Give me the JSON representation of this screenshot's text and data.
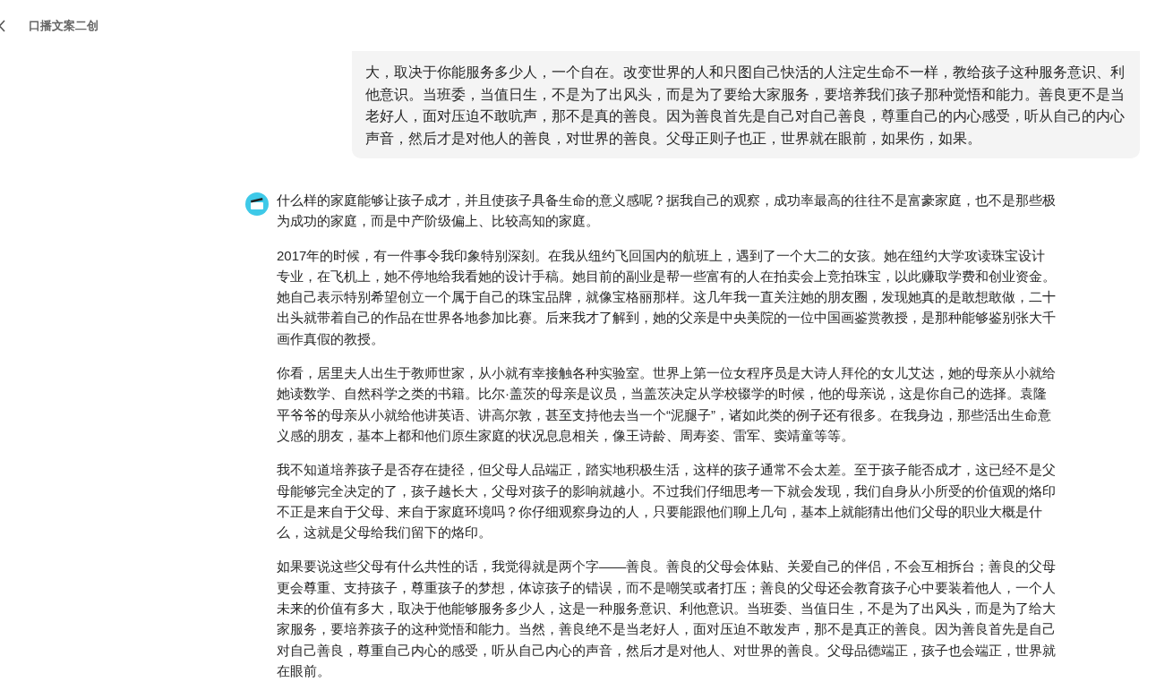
{
  "header": {
    "title": "口播文案二创"
  },
  "user_message": {
    "lines": [
      "大，取决于你能服务多少人，一个自在。改变世界的人和只图自己快活的人注定生命不一样，教给孩子这种服务意识、利",
      "他意识。当班委，当值日生，不是为了出风头，而是为了要给大家服务，要培养我们孩子那种觉悟和能力。善良更不是当",
      "老好人，面对压迫不敢吭声，那不是真的善良。因为善良首先是自己对自己善良，尊重自己的内心感受，听从自己的内心",
      "声音，然后才是对他人的善良，对世界的善良。父母正则子也正，世界就在眼前，如果伤，如果。"
    ]
  },
  "assistant_message": {
    "paragraphs": [
      {
        "lines": [
          "什么样的家庭能够让孩子成才，并且使孩子具备生命的意义感呢？据我自己的观察，成功率最高的往往不是富豪家庭，也不是那些极",
          "为成功的家庭，而是中产阶级偏上、比较高知的家庭。"
        ]
      },
      {
        "lines": [
          "2017年的时候，有一件事令我印象特别深刻。在我从纽约飞回国内的航班上，遇到了一个大二的女孩。她在纽约大学攻读珠宝设计",
          "专业，在飞机上，她不停地给我看她的设计手稿。她目前的副业是帮一些富有的人在拍卖会上竞拍珠宝，以此赚取学费和创业资金。",
          "她自己表示特别希望创立一个属于自己的珠宝品牌，就像宝格丽那样。这几年我一直关注她的朋友圈，发现她真的是敢想敢做，二十",
          "出头就带着自己的作品在世界各地参加比赛。后来我才了解到，她的父亲是中央美院的一位中国画鉴赏教授，是那种能够鉴别张大千",
          "画作真假的教授。"
        ]
      },
      {
        "lines": [
          "你看，居里夫人出生于教师世家，从小就有幸接触各种实验室。世界上第一位女程序员是大诗人拜伦的女儿艾达，她的母亲从小就给",
          "她读数学、自然科学之类的书籍。比尔·盖茨的母亲是议员，当盖茨决定从学校辍学的时候，他的母亲说，这是你自己的选择。袁隆",
          "平爷爷的母亲从小就给他讲英语、讲高尔敦，甚至支持他去当一个“泥腿子”，诸如此类的例子还有很多。在我身边，那些活出生命意",
          "义感的朋友，基本上都和他们原生家庭的状况息息相关，像王诗龄、周寿姿、雷军、窦靖童等等。"
        ]
      },
      {
        "lines": [
          "我不知道培养孩子是否存在捷径，但父母人品端正，踏实地积极生活，这样的孩子通常不会太差。至于孩子能否成才，这已经不是父",
          "母能够完全决定的了，孩子越长大，父母对孩子的影响就越小。不过我们仔细思考一下就会发现，我们自身从小所受的价值观的烙印",
          "不正是来自于父母、来自于家庭环境吗？你仔细观察身边的人，只要能跟他们聊上几句，基本上就能猜出他们父母的职业大概是什",
          "么，这就是父母给我们留下的烙印。"
        ]
      },
      {
        "lines": [
          "如果要说这些父母有什么共性的话，我觉得就是两个字——善良。善良的父母会体贴、关爱自己的伴侣，不会互相拆台；善良的父母",
          "更会尊重、支持孩子，尊重孩子的梦想，体谅孩子的错误，而不是嘲笑或者打压；善良的父母还会教育孩子心中要装着他人，一个人",
          "未来的价值有多大，取决于他能够服务多少人，这是一种服务意识、利他意识。当班委、当值日生，不是为了出风头，而是为了给大",
          "家服务，要培养孩子的这种觉悟和能力。当然，善良绝不是当老好人，面对压迫不敢发声，那不是真正的善良。因为善良首先是自己",
          "对自己善良，尊重自己内心的感受，听从自己内心的声音，然后才是对他人、对世界的善良。父母品德端正，孩子也会端正，世界就",
          "在眼前。"
        ]
      }
    ]
  }
}
